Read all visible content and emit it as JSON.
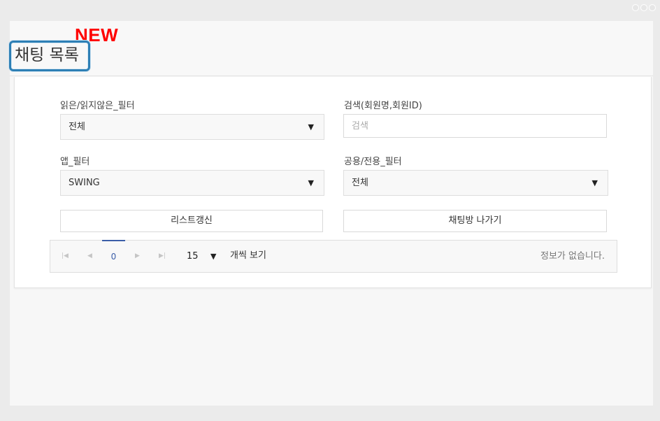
{
  "header": {
    "badge": "NEW",
    "title": "채팅 목록"
  },
  "filters": {
    "read_filter": {
      "label": "읽은/읽지않은_필터",
      "value": "전체"
    },
    "search": {
      "label": "검색(회원명,회원ID)",
      "placeholder": "검색",
      "value": ""
    },
    "app_filter": {
      "label": "앱_필터",
      "value": "SWING"
    },
    "scope_filter": {
      "label": "공용/전용_필터",
      "value": "전체"
    }
  },
  "actions": {
    "refresh_label": "리스트갱신",
    "leave_label": "채팅방 나가기"
  },
  "pager": {
    "first_icon": "first-page-icon",
    "prev_icon": "prev-page-icon",
    "next_icon": "next-page-icon",
    "last_icon": "last-page-icon",
    "current_page": "0",
    "page_size": "15",
    "per_page_label": "개씩 보기",
    "info": "정보가 없습니다."
  }
}
